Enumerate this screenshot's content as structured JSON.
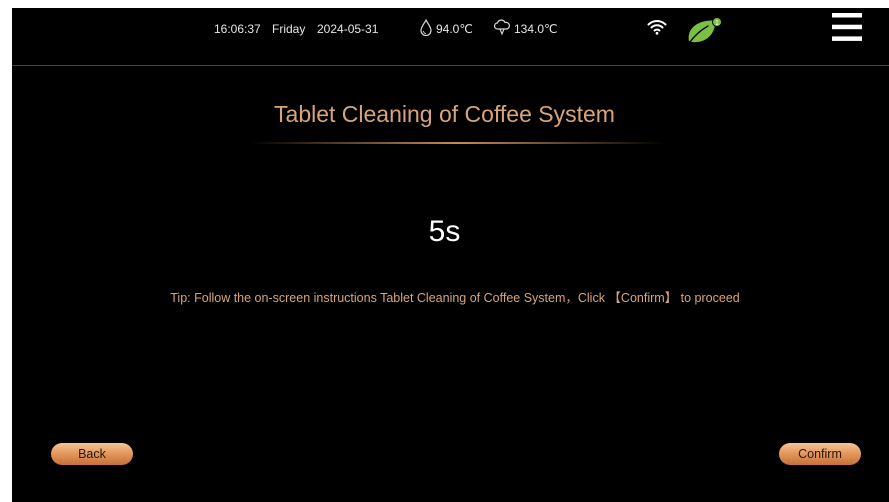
{
  "status_bar": {
    "time": "16:06:37",
    "day": "Friday",
    "date": "2024-05-31",
    "temperature_1": "94.0℃",
    "temperature_2": "134.0℃",
    "icons": [
      "water-drop-icon",
      "steam-cloud-icon",
      "wifi-icon",
      "leaf-icon",
      "menu-icon"
    ],
    "leaf_badge": "1"
  },
  "main": {
    "title": "Tablet Cleaning of Coffee System",
    "countdown": "5s",
    "tip": "Tip: Follow the on-screen instructions Tablet Cleaning of Coffee System，Click 【Confirm】 to proceed"
  },
  "buttons": {
    "back_label": "Back",
    "confirm_label": "Confirm"
  },
  "colors": {
    "background": "#000000",
    "accent_text": "#d8a57a",
    "button_orange": "#e59a5d",
    "leaf_green": "#7bc043"
  }
}
